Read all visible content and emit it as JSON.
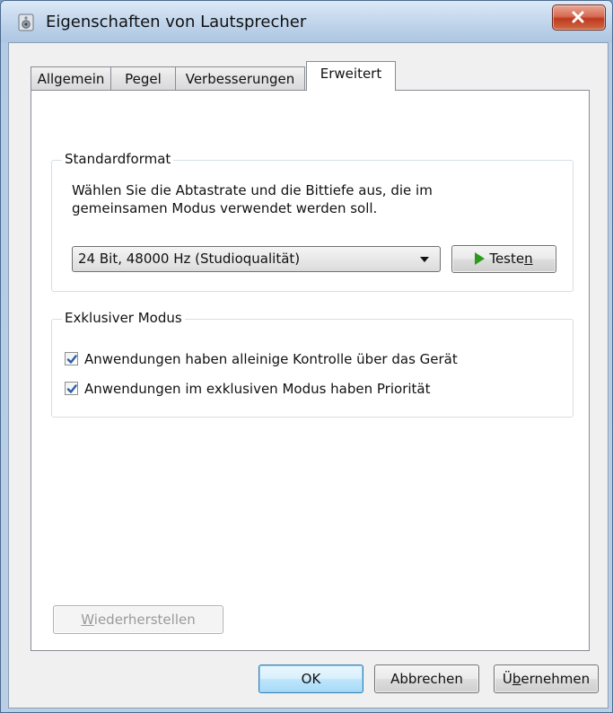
{
  "window": {
    "title": "Eigenschaften von Lautsprecher"
  },
  "tabs": [
    {
      "label": "Allgemein",
      "active": false
    },
    {
      "label": "Pegel",
      "active": false
    },
    {
      "label": "Verbesserungen",
      "active": false
    },
    {
      "label": "Erweitert",
      "active": true
    }
  ],
  "standardformat": {
    "group_label": "Standardformat",
    "description_line1": "Wählen Sie die Abtastrate und die Bittiefe aus, die im",
    "description_line2": "gemeinsamen Modus verwendet werden soll.",
    "selected_format": "24 Bit, 48000 Hz (Studioqualität)",
    "test_label_pre": "Teste",
    "test_label_accel": "n"
  },
  "exclusive": {
    "group_label": "Exklusiver Modus",
    "options": [
      {
        "label": "Anwendungen haben alleinige Kontrolle über das Gerät",
        "checked": true
      },
      {
        "label": "Anwendungen im exklusiven Modus haben Priorität",
        "checked": true
      }
    ]
  },
  "restore": {
    "accel": "W",
    "rest": "iederherstellen"
  },
  "footer": {
    "ok_label": "OK",
    "cancel_label": "Abbrechen",
    "apply_pre": "Ü",
    "apply_accel": "b",
    "apply_post": "ernehmen"
  },
  "colors": {
    "accent": "#3c7fb1",
    "play_green": "#2c9a1c",
    "check_blue": "#2a5ea8",
    "close_red": "#c0391f"
  }
}
